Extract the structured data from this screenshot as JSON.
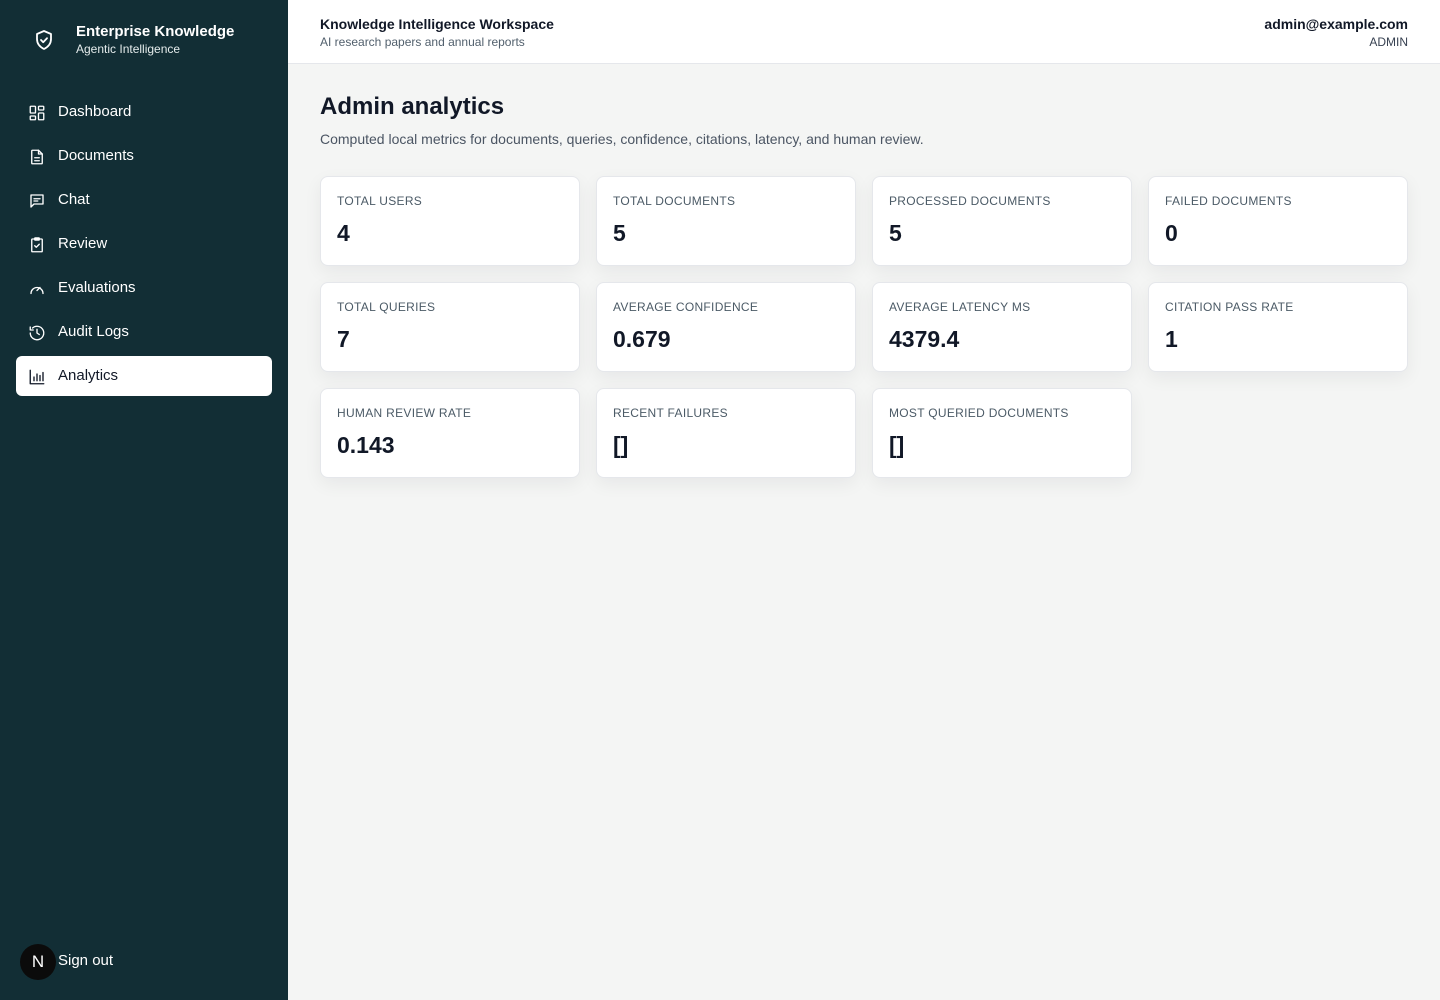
{
  "brand": {
    "title": "Enterprise Knowledge",
    "subtitle": "Agentic Intelligence",
    "icon": "shield-check-icon"
  },
  "sidebar": {
    "items": [
      {
        "label": "Dashboard",
        "icon": "layout-dashboard-icon",
        "active": false
      },
      {
        "label": "Documents",
        "icon": "file-text-icon",
        "active": false
      },
      {
        "label": "Chat",
        "icon": "message-square-icon",
        "active": false
      },
      {
        "label": "Review",
        "icon": "clipboard-check-icon",
        "active": false
      },
      {
        "label": "Evaluations",
        "icon": "gauge-icon",
        "active": false
      },
      {
        "label": "Audit Logs",
        "icon": "history-icon",
        "active": false
      },
      {
        "label": "Analytics",
        "icon": "bar-chart-icon",
        "active": true
      }
    ],
    "signout_label": "Sign out",
    "avatar_letter": "N"
  },
  "header": {
    "title": "Knowledge Intelligence Workspace",
    "subtitle": "AI research papers and annual reports",
    "user_email": "admin@example.com",
    "user_role": "ADMIN"
  },
  "main": {
    "title": "Admin analytics",
    "description": "Computed local metrics for documents, queries, confidence, citations, latency, and human review.",
    "metrics": [
      {
        "label": "TOTAL USERS",
        "value": "4"
      },
      {
        "label": "TOTAL DOCUMENTS",
        "value": "5"
      },
      {
        "label": "PROCESSED DOCUMENTS",
        "value": "5"
      },
      {
        "label": "FAILED DOCUMENTS",
        "value": "0"
      },
      {
        "label": "TOTAL QUERIES",
        "value": "7"
      },
      {
        "label": "AVERAGE CONFIDENCE",
        "value": "0.679"
      },
      {
        "label": "AVERAGE LATENCY MS",
        "value": "4379.4"
      },
      {
        "label": "CITATION PASS RATE",
        "value": "1"
      },
      {
        "label": "HUMAN REVIEW RATE",
        "value": "0.143"
      },
      {
        "label": "RECENT FAILURES",
        "value": "[]"
      },
      {
        "label": "MOST QUERIED DOCUMENTS",
        "value": "[]"
      }
    ]
  },
  "colors": {
    "sidebar_bg": "#122e35",
    "page_bg": "#f4f5f4",
    "active_item_bg": "#ffffff"
  }
}
